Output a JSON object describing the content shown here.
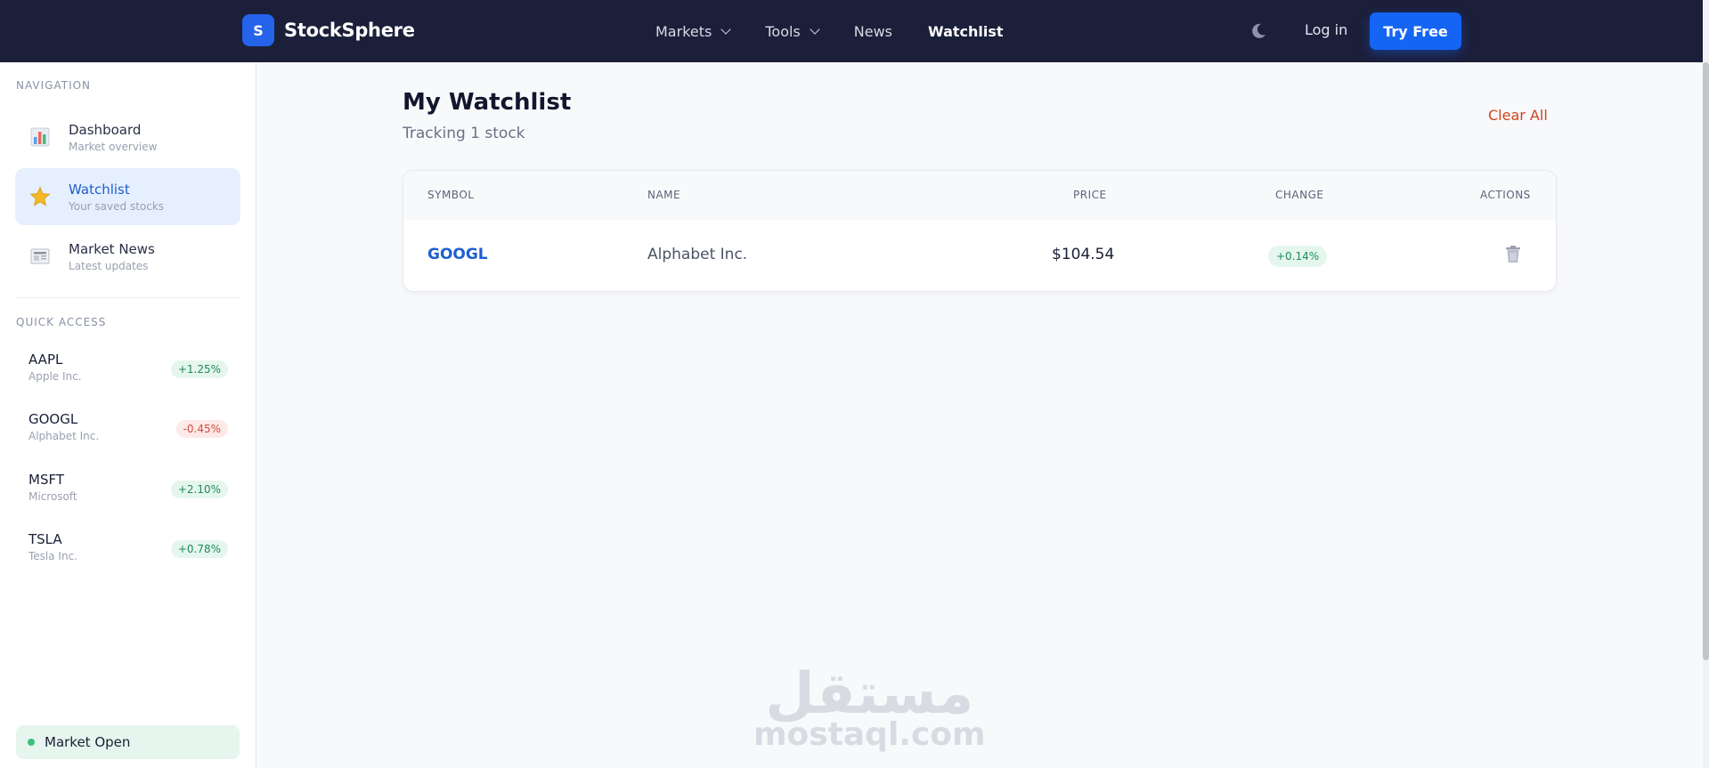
{
  "topbar": {
    "logo_letter": "S",
    "brand": "StockSphere",
    "nav": [
      {
        "label": "Markets"
      },
      {
        "label": "Tools"
      },
      {
        "label": "News"
      },
      {
        "label": "Watchlist"
      }
    ],
    "login": "Log in",
    "try_free": "Try Free"
  },
  "sidebar": {
    "nav_title": "NAVIGATION",
    "items": [
      {
        "label": "Dashboard",
        "sub": "Market overview"
      },
      {
        "label": "Watchlist",
        "sub": "Your saved stocks"
      },
      {
        "label": "Market News",
        "sub": "Latest updates"
      }
    ],
    "quick_title": "QUICK ACCESS",
    "quick": [
      {
        "symbol": "AAPL",
        "name": "Apple Inc.",
        "change": "+1.25%"
      },
      {
        "symbol": "GOOGL",
        "name": "Alphabet Inc.",
        "change": "-0.45%"
      },
      {
        "symbol": "MSFT",
        "name": "Microsoft",
        "change": "+2.10%"
      },
      {
        "symbol": "TSLA",
        "name": "Tesla Inc.",
        "change": "+0.78%"
      }
    ],
    "market_status": "Market Open"
  },
  "main": {
    "title": "My Watchlist",
    "subtitle": "Tracking 1 stock",
    "clear_all": "Clear All",
    "columns": [
      "SYMBOL",
      "NAME",
      "PRICE",
      "CHANGE",
      "ACTIONS"
    ],
    "rows": [
      {
        "symbol": "GOOGL",
        "name": "Alphabet Inc.",
        "price": "$104.54",
        "change": "+0.14%"
      }
    ]
  },
  "watermark": {
    "arabic": "مستقل",
    "latin": "mostaql.com"
  },
  "colors": {
    "topbar": "#1b1f3a",
    "accent": "#1565f5",
    "positive": "#1f8a5b",
    "negative": "#d14b3b",
    "clear_all": "#d0441f"
  },
  "icons": {
    "dashboard": "bar-chart-icon",
    "watchlist": "star-icon",
    "news": "newspaper-icon",
    "theme": "moon-icon",
    "delete": "trash-icon"
  }
}
